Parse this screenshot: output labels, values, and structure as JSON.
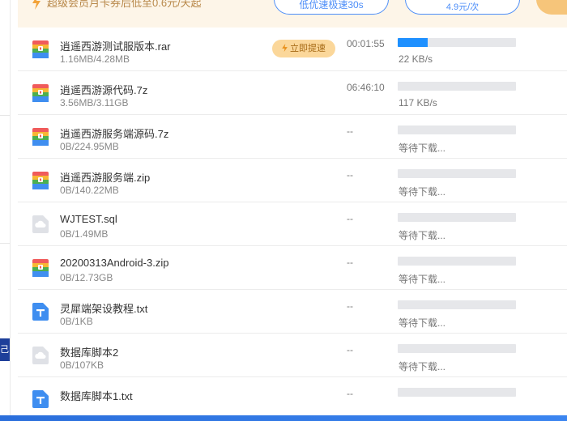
{
  "banner": {
    "promo_text": "超级会员月卡券后低至0.6元/天起",
    "trial_label": "低优速极速30s",
    "month_line1": "",
    "month_price": "4.9元/次"
  },
  "sidebar": {
    "badge_text": "己"
  },
  "speedup_label": "立即提速",
  "files": [
    {
      "name": "逍遥西游测试服版本.rar",
      "size": "1.16MB/4.28MB",
      "time": "00:01:55",
      "progress": 0.25,
      "status": "22 KB/s",
      "type": "archive",
      "speedup": true
    },
    {
      "name": "逍遥西游源代码.7z",
      "size": "3.56MB/3.11GB",
      "time": "06:46:10",
      "progress": 0.0,
      "status": "117 KB/s",
      "type": "archive",
      "speedup": false
    },
    {
      "name": "逍遥西游服务端源码.7z",
      "size": "0B/224.95MB",
      "time": "--",
      "progress": 0.0,
      "status": "等待下载...",
      "type": "archive",
      "speedup": false
    },
    {
      "name": "逍遥西游服务端.zip",
      "size": "0B/140.22MB",
      "time": "--",
      "progress": 0.0,
      "status": "等待下载...",
      "type": "archive",
      "speedup": false
    },
    {
      "name": "WJTEST.sql",
      "size": "0B/1.49MB",
      "time": "--",
      "progress": 0.0,
      "status": "等待下载...",
      "type": "generic",
      "speedup": false
    },
    {
      "name": "20200313Android-3.zip",
      "size": "0B/12.73GB",
      "time": "--",
      "progress": 0.0,
      "status": "等待下载...",
      "type": "archive",
      "speedup": false
    },
    {
      "name": "灵犀端架设教程.txt",
      "size": "0B/1KB",
      "time": "--",
      "progress": 0.0,
      "status": "等待下载...",
      "type": "text",
      "speedup": false
    },
    {
      "name": "数据库脚本2",
      "size": "0B/107KB",
      "time": "--",
      "progress": 0.0,
      "status": "等待下载...",
      "type": "generic",
      "speedup": false
    },
    {
      "name": "数据库脚本1.txt",
      "size": "",
      "time": "--",
      "progress": 0.0,
      "status": "",
      "type": "text",
      "speedup": false
    }
  ],
  "colors": {
    "accent": "#1e90ff",
    "banner_bg": "#fdf5e8",
    "speedup_bg": "#fbd79a"
  }
}
